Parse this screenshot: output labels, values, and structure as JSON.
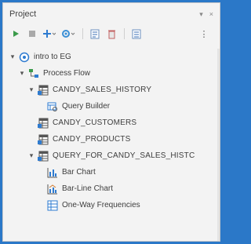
{
  "panel": {
    "title": "Project",
    "pin_glyph": "▾",
    "close_glyph": "×"
  },
  "toolbar": {
    "icons": [
      "run-icon",
      "stop-icon",
      "add-icon",
      "tools-icon",
      "schedule-icon",
      "delete-icon",
      "properties-icon",
      "more-icon"
    ],
    "more_glyph": "⋮"
  },
  "tree": {
    "project": {
      "label": "intro to EG",
      "icon": "project-icon"
    },
    "process_flow": {
      "label": "Process Flow",
      "icon": "process-flow-icon"
    },
    "candy_sales_history": {
      "label": "CANDY_SALES_HISTORY",
      "icon": "table-icon"
    },
    "query_builder": {
      "label": "Query Builder",
      "icon": "query-builder-icon"
    },
    "candy_customers": {
      "label": "CANDY_CUSTOMERS",
      "icon": "table-icon"
    },
    "candy_products": {
      "label": "CANDY_PRODUCTS",
      "icon": "table-icon"
    },
    "query_for_candy": {
      "label": "QUERY_FOR_CANDY_SALES_HISTC",
      "icon": "table-icon"
    },
    "bar_chart": {
      "label": "Bar Chart",
      "icon": "bar-chart-icon"
    },
    "bar_line_chart": {
      "label": "Bar-Line Chart",
      "icon": "bar-line-chart-icon"
    },
    "one_way_freq": {
      "label": "One-Way Frequencies",
      "icon": "frequencies-icon"
    }
  },
  "colors": {
    "accent": "#2b78c8",
    "run_green": "#3b9a4a"
  }
}
